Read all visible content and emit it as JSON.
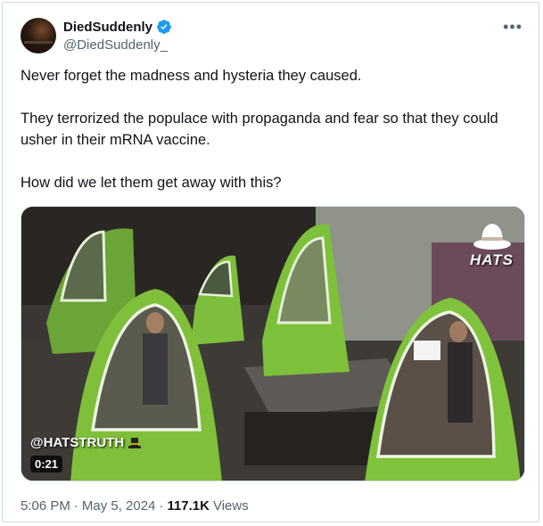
{
  "tweet": {
    "display_name": "DiedSuddenly",
    "handle": "@DiedSuddenly_",
    "more_label": "•••",
    "paragraphs": [
      "Never forget the madness and hysteria they caused.",
      "They terrorized the populace with propaganda and fear so that they could usher in their mRNA vaccine.",
      "How did we let them get away with this?"
    ],
    "media": {
      "watermark_top": "HATS",
      "watermark_bottom": "@HATSTRUTH",
      "duration": "0:21"
    },
    "meta": {
      "time": "5:06 PM",
      "separator": "·",
      "date": "May 5, 2024",
      "separator2": "·",
      "views_count": "117.1K",
      "views_label": "Views"
    }
  },
  "colors": {
    "verified_blue": "#1d9bf0",
    "text_primary": "#0f1419",
    "text_secondary": "#536471",
    "tent_green": "#7fbf3a"
  },
  "icons": [
    "verified-badge-icon",
    "more-options-icon",
    "hat-icon",
    "tophat-icon"
  ]
}
